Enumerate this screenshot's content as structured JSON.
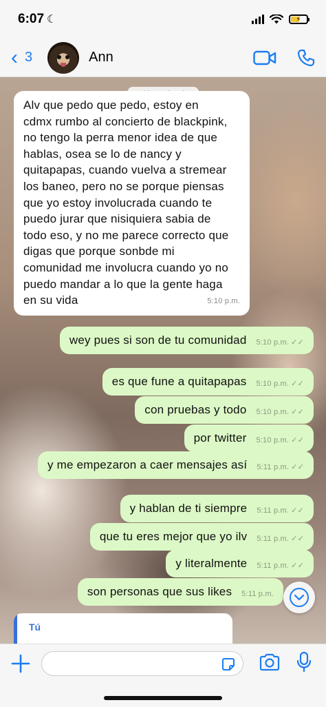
{
  "status_bar": {
    "time": "6:07",
    "moon_icon": "moon-icon",
    "battery_level": 0.5,
    "battery_color": "#f4c430"
  },
  "header": {
    "back_count": "3",
    "contact_name": "Ann",
    "accent_color": "#1b7cf2",
    "icons": [
      "video-call-icon",
      "phone-icon"
    ]
  },
  "chat": {
    "date_label": "mié 26 de abr",
    "incoming": {
      "text": "Alv que pedo que pedo, estoy en cdmx rumbo al concierto de blackpink, no tengo la perra menor idea de que hablas, osea se lo de nancy y quitapapas, cuando vuelva a stremear los baneo, pero no se porque piensas que yo estoy involucrada cuando te puedo jurar que nisiquiera sabia de todo eso, y no me parece correcto que digas que porque sonbde mi comunidad me involucra cuando yo no puedo mandar a lo que la gente haga en su vida",
      "time": "5:10 p.m."
    },
    "outgoing": [
      {
        "text": "wey pues si son de tu comunidad",
        "time": "5:10 p.m."
      },
      {
        "text": "es que fune a quitapapas",
        "time": "5:10 p.m."
      },
      {
        "text": "con pruebas y todo",
        "time": "5:10 p.m."
      },
      {
        "text": "por twitter",
        "time": "5:10 p.m."
      },
      {
        "text": "y me empezaron a caer mensajes así",
        "time": "5:11 p.m."
      },
      {
        "text": "y hablan de ti siempre",
        "time": "5:11 p.m."
      },
      {
        "text": "que tu eres mejor que yo ilv",
        "time": "5:11 p.m."
      },
      {
        "text": "y literalmente",
        "time": "5:11 p.m."
      },
      {
        "text": "son personas que sus likes",
        "time": "5:11 p.m."
      }
    ],
    "reply_preview": {
      "author": "Tú"
    },
    "outgoing_bubble_color": "#dcf8c6"
  },
  "composer": {
    "placeholder": "",
    "icons": [
      "plus-icon",
      "sticker-icon",
      "camera-icon",
      "microphone-icon"
    ]
  }
}
